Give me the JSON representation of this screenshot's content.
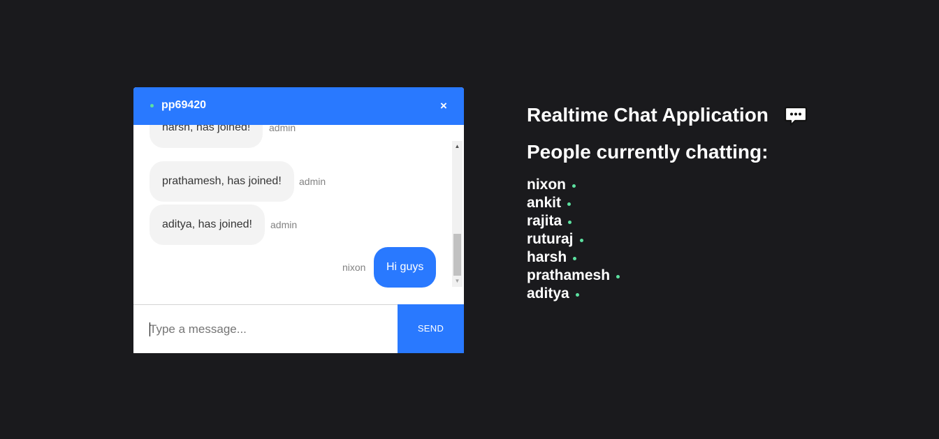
{
  "chat": {
    "room_name": "pp69420",
    "close_label": "×",
    "messages": [
      {
        "text": "harsh, has joined!",
        "sender": "admin",
        "own": false
      },
      {
        "text": "prathamesh, has joined!",
        "sender": "admin",
        "own": false
      },
      {
        "text": "aditya, has joined!",
        "sender": "admin",
        "own": false
      },
      {
        "text": "Hi guys",
        "sender": "nixon",
        "own": true
      }
    ],
    "input_placeholder": "Type a message...",
    "input_value": "",
    "send_label": "SEND"
  },
  "info": {
    "title": "Realtime Chat Application",
    "title_icon": "speech-bubble-icon",
    "people_heading": "People currently chatting:",
    "people": [
      "nixon",
      "ankit",
      "rajita",
      "ruturaj",
      "harsh",
      "prathamesh",
      "aditya"
    ]
  },
  "colors": {
    "background": "#1a1a1d",
    "accent": "#2979ff",
    "online": "#5ce1a0",
    "bubble_light": "#f3f3f3"
  }
}
